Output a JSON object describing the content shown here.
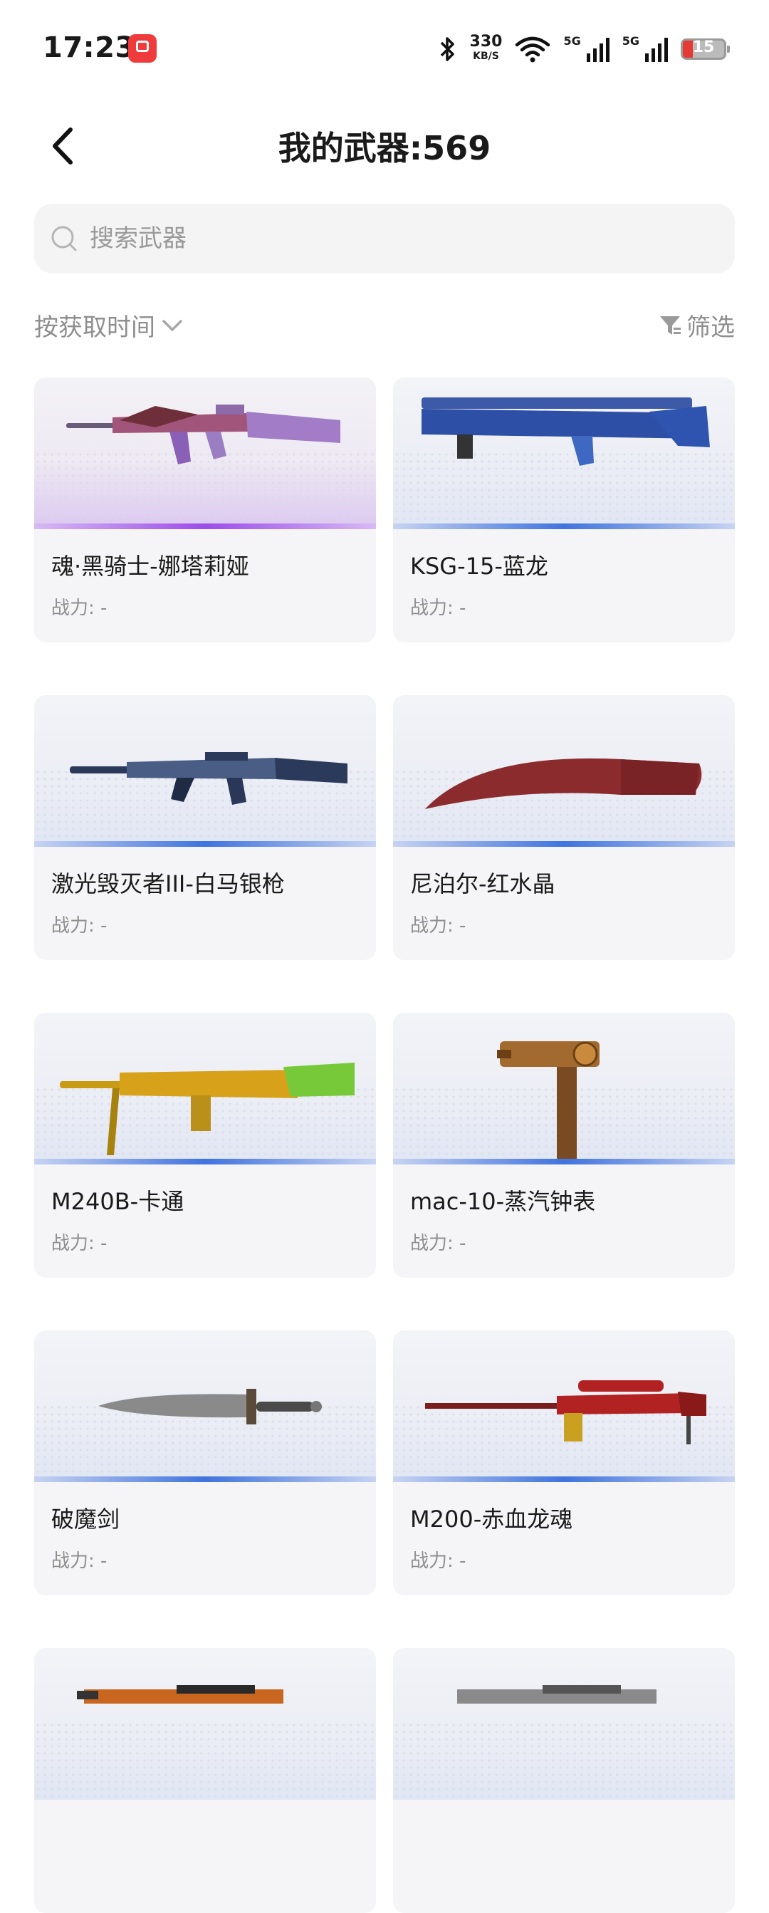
{
  "status_bar": {
    "time": "17:23",
    "net_speed": "330",
    "net_unit": "KB/S",
    "signal1": "5G",
    "signal2": "5G",
    "battery": "15"
  },
  "header": {
    "title": "我的武器:569"
  },
  "search": {
    "placeholder": "搜索武器"
  },
  "sort": {
    "label": "按获取时间"
  },
  "filter": {
    "label": "筛选"
  },
  "weapons": [
    {
      "name": "魂·黑骑士-娜塔莉娅",
      "power": "战力: -",
      "rarity": "purple"
    },
    {
      "name": "KSG-15-蓝龙",
      "power": "战力: -",
      "rarity": "blue"
    },
    {
      "name": "激光毁灭者III-白马银枪",
      "power": "战力: -",
      "rarity": "blue"
    },
    {
      "name": "尼泊尔-红水晶",
      "power": "战力: -",
      "rarity": "blue"
    },
    {
      "name": "M240B-卡通",
      "power": "战力: -",
      "rarity": "blue"
    },
    {
      "name": "mac-10-蒸汽钟表",
      "power": "战力: -",
      "rarity": "blue"
    },
    {
      "name": "破魔剑",
      "power": "战力: -",
      "rarity": "blue"
    },
    {
      "name": "M200-赤血龙魂",
      "power": "战力: -",
      "rarity": "blue"
    },
    {
      "name": "",
      "power": "",
      "rarity": "blue"
    },
    {
      "name": "",
      "power": "",
      "rarity": "blue"
    }
  ]
}
